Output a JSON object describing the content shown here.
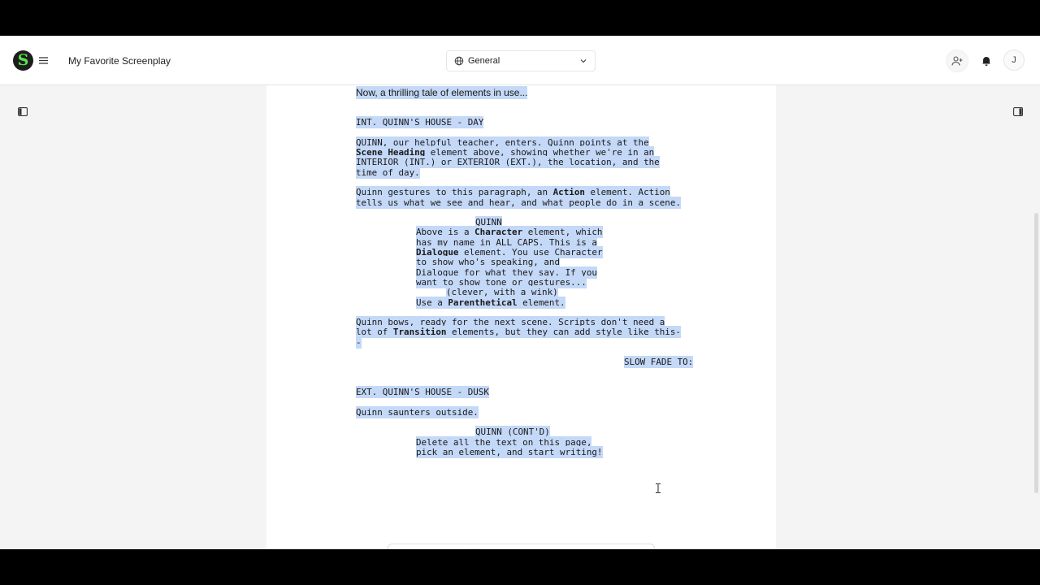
{
  "header": {
    "doc_title": "My Favorite Screenplay",
    "dropdown_label": "General",
    "avatar_initial": "J"
  },
  "colors": {
    "selection": "#c4d8f7",
    "logo_bg": "#1d1d1d",
    "logo_accent": "#5be14a"
  },
  "icons": {
    "logo": "script-s-logo-icon",
    "menu": "hamburger-menu-icon",
    "globe": "globe-icon",
    "chevron": "chevron-down-icon",
    "invite": "add-user-icon",
    "bell": "bell-icon",
    "sidebar_left": "sidebar-left-icon",
    "sidebar_right": "sidebar-right-icon",
    "text_cursor": "text-cursor-icon"
  },
  "script": {
    "intro": "Now, a thrilling tale of elements in use...",
    "scene1": "INT. QUINN'S HOUSE - DAY",
    "action1_l1": "QUINN, our helpful teacher, enters. Quinn points at the",
    "action1_l2a": "Scene Heading",
    "action1_l2b": " element above, showing whether we're in an",
    "action1_l3": "INTERIOR (INT.) or EXTERIOR (EXT.), the location, and the",
    "action1_l4": "time of day.",
    "action2_l1a": "Quinn gestures to this paragraph, an ",
    "action2_l1b": "Action",
    "action2_l1c": " element. Action",
    "action2_l2": "tells us what we see and hear, and what people do in a scene.",
    "character1": "QUINN",
    "dlg_l1a": "Above is a ",
    "dlg_l1b": "Character",
    "dlg_l1c": " element, which",
    "dlg_l2": "has my name in ALL CAPS. This is a",
    "dlg_l3a": "Dialogue",
    "dlg_l3b": " element. You use Character",
    "dlg_l4": "to show who's speaking, and",
    "dlg_l5": "Dialogue for what they say. If you",
    "dlg_l6": "want to show tone or gestures...",
    "parenthetical": "(clever, with a wink)",
    "dlg2_a": "Use a ",
    "dlg2_b": "Parenthetical",
    "dlg2_c": " element.",
    "action3_l1": "Quinn bows, ready for the next scene. Scripts don't need a",
    "action3_l2a": "lot of ",
    "action3_l2b": "Transition",
    "action3_l2c": " elements, but they can add style like this-",
    "action3_l3": "-",
    "transition": "SLOW FADE TO:",
    "scene2": "EXT. QUINN'S HOUSE - DUSK",
    "action4": "Quinn saunters outside.",
    "character2": "QUINN (CONT'D)",
    "dlg3_l1": "Delete all the text on this page,",
    "dlg3_l2": "pick an element, and start writing!"
  },
  "toolbar": {
    "buttons": [
      "undo",
      "redo",
      "globe",
      "bold",
      "italic",
      "underline",
      "strikethrough",
      "text",
      "mention",
      "comments",
      "comment"
    ],
    "active": "bold",
    "icons": [
      "undo-icon",
      "redo-icon",
      "globe-icon",
      "bold-icon",
      "italic-icon",
      "underline-icon",
      "strikethrough-icon",
      "text-style-icon",
      "mention-icon",
      "comments-icon",
      "comment-icon"
    ]
  }
}
